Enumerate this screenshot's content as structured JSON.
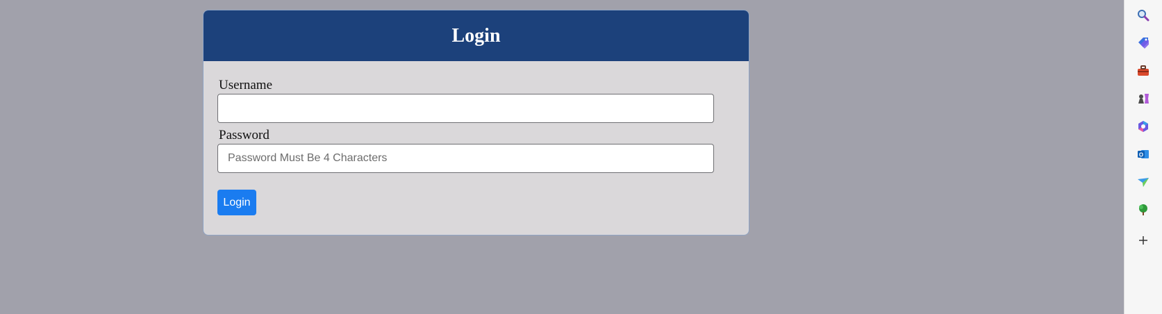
{
  "login_card": {
    "title": "Login",
    "username_label": "Username",
    "username_value": "",
    "password_label": "Password",
    "password_placeholder": "Password Must Be 4 Characters",
    "submit_label": "Login"
  },
  "sidebar": {
    "icons": [
      "search-icon",
      "tag-icon",
      "toolbox-icon",
      "chess-icon",
      "copilot-icon",
      "outlook-icon",
      "send-icon",
      "tree-icon",
      "plus-icon"
    ]
  },
  "colors": {
    "page_background": "#a1a1ab",
    "header": "#1c417b",
    "card_body": "#dad8da",
    "button": "#1a7cf0"
  }
}
